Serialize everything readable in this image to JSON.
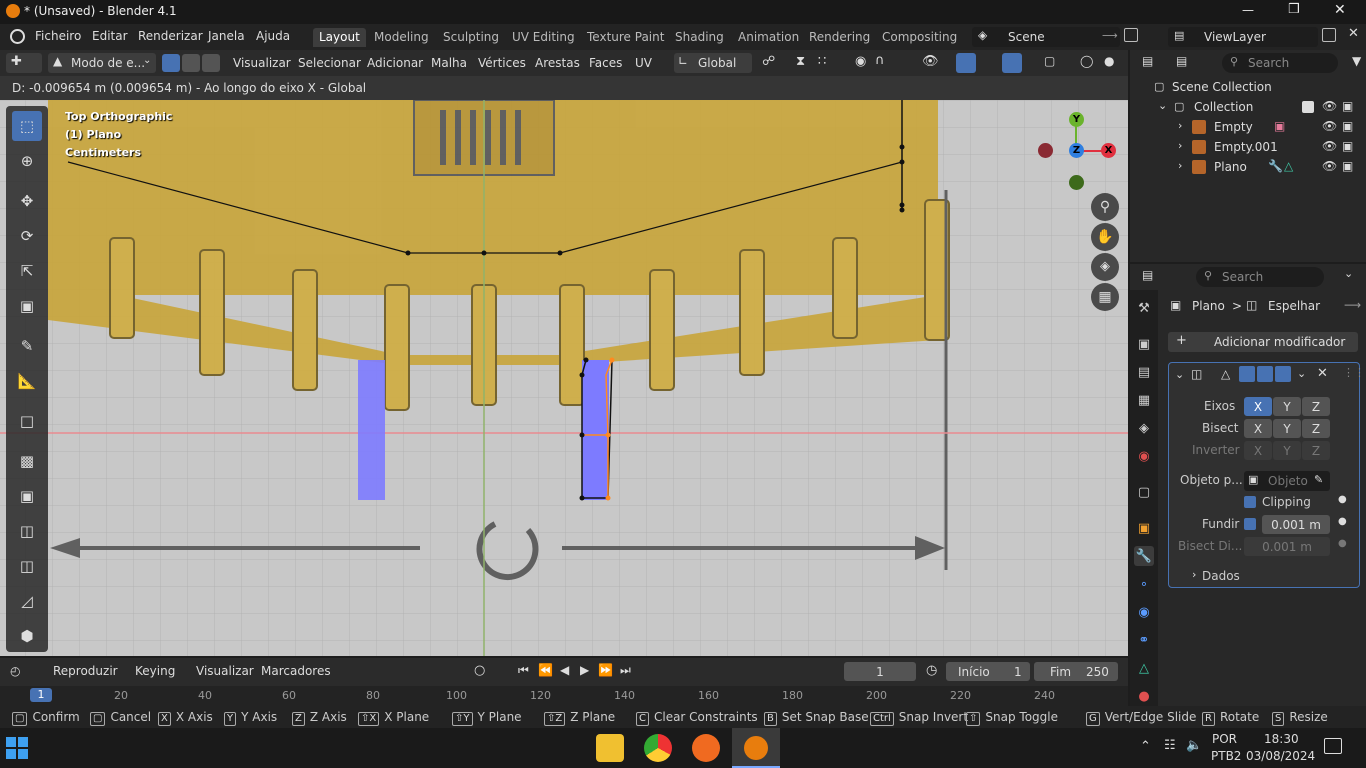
{
  "titlebar": {
    "title": "* (Unsaved) - Blender 4.1",
    "minimize": "—",
    "maximize": "❒",
    "close": "✕"
  },
  "menu": {
    "items": [
      "Ficheiro",
      "Editar",
      "Renderizar",
      "Janela",
      "Ajuda"
    ]
  },
  "workspaces": [
    "Layout",
    "Modeling",
    "Sculpting",
    "UV Editing",
    "Texture Paint",
    "Shading",
    "Animation",
    "Rendering",
    "Compositing"
  ],
  "scene": {
    "label": "Scene",
    "viewlayer": "ViewLayer"
  },
  "viewport_header": {
    "mode": "Modo de e...",
    "menus": [
      "Visualizar",
      "Selecionar",
      "Adicionar",
      "Malha",
      "Vértices",
      "Arestas",
      "Faces",
      "UV"
    ],
    "orientation": "Global",
    "search_placeholder": "Search"
  },
  "status_text": "D: -0.009654 m (0.009654 m) - Ao longo do eixo X - Global",
  "viewport_info": {
    "view": "Top Orthographic",
    "object": "(1) Plano",
    "units": "Centimeters"
  },
  "gizmo": {
    "y": "Y",
    "z": "Z",
    "x": "X"
  },
  "outliner": {
    "search_placeholder": "Search",
    "root": "Scene Collection",
    "collection": "Collection",
    "items": [
      "Empty",
      "Empty.001",
      "Plano"
    ]
  },
  "properties": {
    "search_placeholder": "Search",
    "breadcrumb_object": "Plano",
    "breadcrumb_sep": ">",
    "breadcrumb_modifier": "Espelhar",
    "add_modifier": "Adicionar modificador",
    "eixos_label": "Eixos",
    "bisect_label": "Bisect",
    "inverter_label": "Inverter",
    "axes": [
      "X",
      "Y",
      "Z"
    ],
    "objeto_label": "Objeto p...",
    "objeto_placeholder": "Objeto",
    "clipping_label": "Clipping",
    "fundir_label": "Fundir",
    "fundir_value": "0.001 m",
    "bisect_dist_label": "Bisect Di...",
    "bisect_dist_value": "0.001 m",
    "dados_label": "Dados"
  },
  "timeline": {
    "menus": [
      "Reproduzir",
      "Keying",
      "Visualizar",
      "Marcadores"
    ],
    "current_frame": "1",
    "start_label": "Início",
    "start_value": "1",
    "end_label": "Fim",
    "end_value": "250",
    "ruler": [
      "1",
      "20",
      "40",
      "60",
      "80",
      "100",
      "120",
      "140",
      "160",
      "180",
      "200",
      "220",
      "240"
    ]
  },
  "keymap": [
    {
      "key": "",
      "label": "Confirm"
    },
    {
      "key": "",
      "label": "Cancel"
    },
    {
      "key": "X",
      "label": "X Axis"
    },
    {
      "key": "Y",
      "label": "Y Axis"
    },
    {
      "key": "Z",
      "label": "Z Axis"
    },
    {
      "key": "⇧X",
      "label": "X Plane"
    },
    {
      "key": "⇧Y",
      "label": "Y Plane"
    },
    {
      "key": "⇧Z",
      "label": "Z Plane"
    },
    {
      "key": "C",
      "label": "Clear Constraints"
    },
    {
      "key": "B",
      "label": "Set Snap Base"
    },
    {
      "key": "Ctrl",
      "label": "Snap Invert"
    },
    {
      "key": "⇧",
      "label": "Snap Toggle"
    },
    {
      "key": "G",
      "label": "Vert/Edge Slide"
    },
    {
      "key": "R",
      "label": "Rotate"
    },
    {
      "key": "S",
      "label": "Resize"
    }
  ],
  "taskbar": {
    "lang": "POR",
    "layout": "PTB2",
    "time": "18:30",
    "date": "03/08/2024"
  },
  "colors": {
    "accent": "#4772b3",
    "x_axis": "#e0303f",
    "y_axis": "#6ab32c",
    "z_axis": "#2f7fe0",
    "mesh_fill": "#7d7bff",
    "ref_image": "#c9a53a"
  }
}
